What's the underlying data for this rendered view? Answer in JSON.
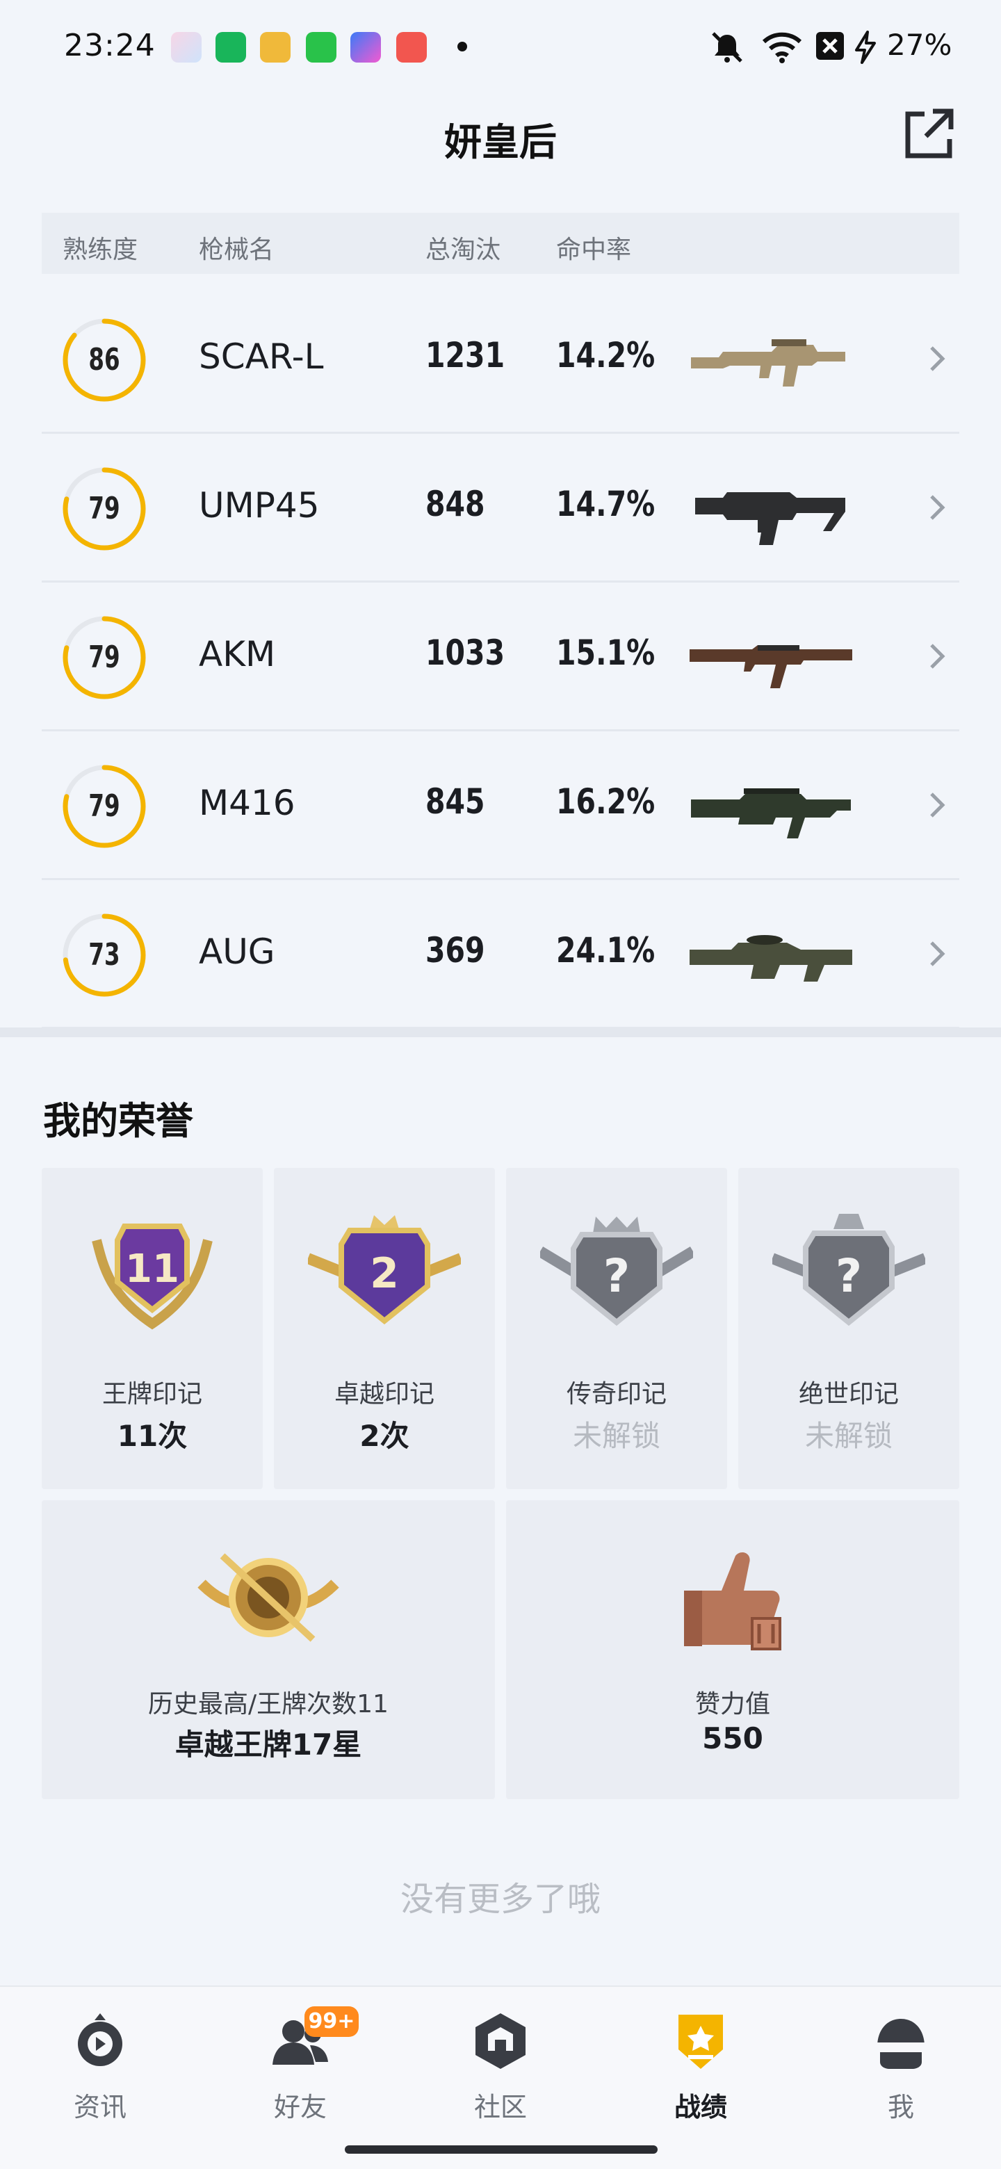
{
  "status_bar": {
    "time": "23:24",
    "battery": "27%",
    "icons": [
      "app-photos-icon",
      "app-shield-icon",
      "app-target-icon",
      "app-grid-icon",
      "app-star-icon",
      "app-video-icon",
      "notification-dot",
      "mute-icon",
      "wifi-icon",
      "sim-x-icon",
      "charging-icon"
    ]
  },
  "header": {
    "title": "妍皇后",
    "share_icon": "share-external-icon"
  },
  "weapon_table": {
    "columns": [
      "熟练度",
      "枪械名",
      "总淘汰",
      "命中率"
    ],
    "rows": [
      {
        "proficiency": "86",
        "name": "SCAR-L",
        "kills": "1231",
        "accuracy": "14.2%",
        "ring_fraction": 0.86,
        "gun": "scar-l-rifle-icon"
      },
      {
        "proficiency": "79",
        "name": "UMP45",
        "kills": "848",
        "accuracy": "14.7%",
        "ring_fraction": 0.79,
        "gun": "ump45-smg-icon"
      },
      {
        "proficiency": "79",
        "name": "AKM",
        "kills": "1033",
        "accuracy": "15.1%",
        "ring_fraction": 0.79,
        "gun": "akm-rifle-icon"
      },
      {
        "proficiency": "79",
        "name": "M416",
        "kills": "845",
        "accuracy": "16.2%",
        "ring_fraction": 0.79,
        "gun": "m416-rifle-icon"
      },
      {
        "proficiency": "73",
        "name": "AUG",
        "kills": "369",
        "accuracy": "24.1%",
        "ring_fraction": 0.73,
        "gun": "aug-rifle-icon"
      }
    ]
  },
  "honors": {
    "title": "我的荣誉",
    "badges": [
      {
        "label": "王牌印记",
        "value": "11次",
        "badge_text": "11",
        "locked": false
      },
      {
        "label": "卓越印记",
        "value": "2次",
        "badge_text": "2",
        "locked": false
      },
      {
        "label": "传奇印记",
        "value": "未解锁",
        "badge_text": "?",
        "locked": true
      },
      {
        "label": "绝世印记",
        "value": "未解锁",
        "badge_text": "?",
        "locked": true
      }
    ],
    "highest": {
      "label": "历史最高/王牌次数11",
      "value": "卓越王牌17星"
    },
    "likes": {
      "label": "赞力值",
      "value": "550"
    }
  },
  "footer_text": "没有更多了哦",
  "bottom_nav": {
    "items": [
      {
        "label": "资讯",
        "icon": "news-icon"
      },
      {
        "label": "好友",
        "icon": "friends-icon",
        "badge": "99+"
      },
      {
        "label": "社区",
        "icon": "community-icon"
      },
      {
        "label": "战绩",
        "icon": "record-icon",
        "active": true
      },
      {
        "label": "我",
        "icon": "profile-helmet-icon"
      }
    ]
  },
  "colors": {
    "accent": "#f4b400",
    "background": "#f2f5fa",
    "nav_badge": "#ff8a1d",
    "locked_text": "#b6bac1"
  }
}
